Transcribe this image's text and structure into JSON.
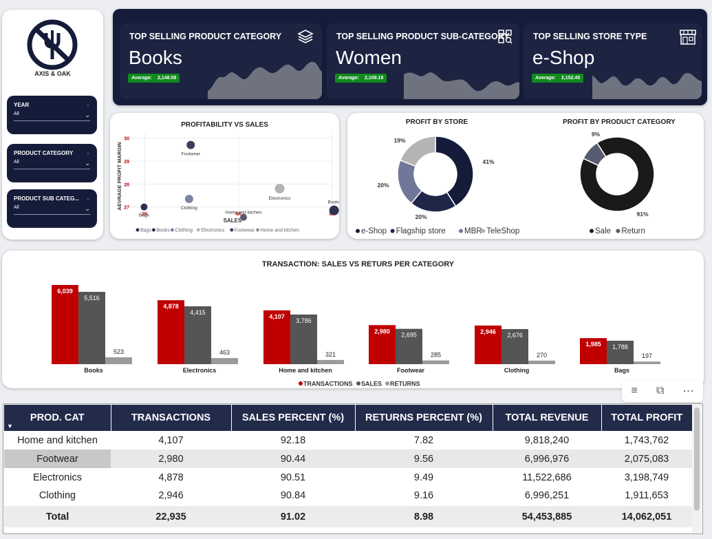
{
  "sidebar": {
    "brand": "AXIS & OAK",
    "slicers": [
      {
        "label": "YEAR",
        "value": "All"
      },
      {
        "label": "PRODUCT CATEGORY",
        "value": "All"
      },
      {
        "label": "PRODUCT SUB CATEG...",
        "value": "All"
      }
    ]
  },
  "kpis": [
    {
      "title": "TOP SELLING PRODUCT CATEGORY",
      "value": "Books",
      "avg_label": "Average:",
      "avg_value": "2,148.08",
      "icon": "layers-icon"
    },
    {
      "title": "TOP SELLING PRODUCT SUB-CATEGORY",
      "value": "Women",
      "avg_label": "Average:",
      "avg_value": "2,109.18",
      "icon": "grid-search-icon"
    },
    {
      "title": "TOP SELLING STORE TYPE",
      "value": "e-Shop",
      "avg_label": "Average:",
      "avg_value": "2,152.45",
      "icon": "store-icon"
    }
  ],
  "scatter": {
    "title": "PROFITABILITY VS SALES",
    "ylabel": "AEVRAGE PROFIT MARGIN",
    "xlabel": "SALES"
  },
  "donuts": {
    "store_title": "PROFIT BY STORE",
    "category_title": "PROFIT BY PRODUCT CATEGORY"
  },
  "bar": {
    "title": "TRANSACTION: SALES VS RETURS PER CATEGORY"
  },
  "table": {
    "headers": [
      "PROD. CAT",
      "TRANSACTIONS",
      "SALES PERCENT (%)",
      "RETURNS PERCENT (%)",
      "TOTAL REVENUE",
      "TOTAL PROFIT"
    ],
    "rows": [
      [
        "Home and kitchen",
        "4,107",
        "92.18",
        "7.82",
        "9,818,240",
        "1,743,762"
      ],
      [
        "Footwear",
        "2,980",
        "90.44",
        "9.56",
        "6,996,976",
        "2,075,083"
      ],
      [
        "Electronics",
        "4,878",
        "90.51",
        "9.49",
        "11,522,686",
        "3,198,749"
      ],
      [
        "Clothing",
        "2,946",
        "90.84",
        "9.16",
        "6,996,251",
        "1,911,653"
      ]
    ],
    "total": [
      "Total",
      "22,935",
      "91.02",
      "8.98",
      "54,453,885",
      "14,062,051"
    ]
  },
  "colors": {
    "navy": "#151c3a",
    "red": "#c00000",
    "dark_gray": "#555555",
    "light_gray": "#9a9a9a",
    "green": "#118a1e"
  },
  "chart_data": [
    {
      "type": "scatter",
      "title": "PROFITABILITY VS SALES",
      "xlabel": "SALES",
      "ylabel": "AEVRAGE PROFIT MARGIN",
      "xticks": [
        "2K",
        "4K",
        "6K"
      ],
      "yticks": [
        "27",
        "28",
        "29",
        "30"
      ],
      "xlim": [
        1700,
        6000
      ],
      "ylim": [
        26.6,
        30.2
      ],
      "series": [
        {
          "name": "Bags",
          "x": 1985,
          "y": 27.0,
          "color": "#2d3250"
        },
        {
          "name": "Books",
          "x": 6039,
          "y": 26.85,
          "color": "#2d3250"
        },
        {
          "name": "Clothing",
          "x": 2946,
          "y": 27.35,
          "color": "#7c84a6"
        },
        {
          "name": "Electronics",
          "x": 4878,
          "y": 27.8,
          "color": "#b4b4b4"
        },
        {
          "name": "Footwear",
          "x": 2980,
          "y": 29.7,
          "color": "#3a3f5c"
        },
        {
          "name": "Home and kitchen",
          "x": 4107,
          "y": 26.55,
          "color": "#555a70"
        }
      ],
      "legend": [
        "Bags",
        "Books",
        "Clothing",
        "Electronics",
        "Footwear",
        "Home and kitchen"
      ],
      "legend_colors": [
        "#2d3250",
        "#2d3250",
        "#7c84a6",
        "#b4b4b4",
        "#3a3f5c",
        "#a09080"
      ]
    },
    {
      "type": "pie",
      "title": "PROFIT BY STORE",
      "labels": [
        "e-Shop",
        "Flagship store",
        "MBR",
        "TeleShop"
      ],
      "values": [
        41,
        20,
        20,
        19
      ],
      "colors": [
        "#151c3a",
        "#1f2647",
        "#717799",
        "#b4b4b4"
      ],
      "percent_labels": [
        "41%",
        "20%",
        "20%",
        "19%"
      ]
    },
    {
      "type": "pie",
      "title": "PROFIT BY PRODUCT CATEGORY",
      "labels": [
        "Sale",
        "Return"
      ],
      "values": [
        91,
        9
      ],
      "colors": [
        "#1a1a1a",
        "#585c72"
      ],
      "percent_labels": [
        "91%",
        "9%"
      ]
    },
    {
      "type": "bar",
      "title": "TRANSACTION: SALES VS RETURS PER CATEGORY",
      "categories": [
        "Books",
        "Electronics",
        "Home and kitchen",
        "Footwear",
        "Clothing",
        "Bags"
      ],
      "series": [
        {
          "name": "TRANSACTIONS",
          "values": [
            6039,
            4878,
            4107,
            2980,
            2946,
            1985
          ],
          "labels": [
            "6,039",
            "4,878",
            "4,107",
            "2,980",
            "2,946",
            "1,985"
          ],
          "color": "#c00000"
        },
        {
          "name": "SALES",
          "values": [
            5516,
            4415,
            3786,
            2695,
            2676,
            1788
          ],
          "labels": [
            "5,516",
            "4,415",
            "3,786",
            "2,695",
            "2,676",
            "1,788"
          ],
          "color": "#555555"
        },
        {
          "name": "RETURNS",
          "values": [
            523,
            463,
            321,
            285,
            270,
            197
          ],
          "labels": [
            "523",
            "463",
            "321",
            "285",
            "270",
            "197"
          ],
          "color": "#9a9a9a"
        }
      ],
      "ylim": [
        0,
        6039
      ]
    }
  ]
}
